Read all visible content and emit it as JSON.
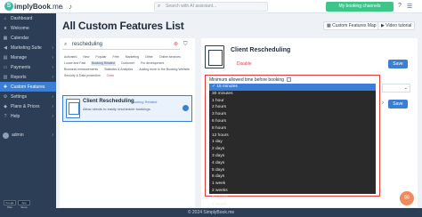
{
  "topbar": {
    "logo_s": "S",
    "logo_text": "implyBook",
    "logo_suffix": ".me",
    "search_placeholder": "Search with AI assistant...",
    "booking_button": "My booking channels"
  },
  "sidebar": {
    "items": [
      {
        "label": "Dashboard",
        "icon": "home-icon",
        "chevron": false
      },
      {
        "label": "Welcome",
        "icon": "star-icon",
        "chevron": false
      },
      {
        "label": "Calendar",
        "icon": "calendar-icon",
        "chevron": false
      },
      {
        "label": "Marketing Suite",
        "icon": "megaphone-icon",
        "chevron": true
      },
      {
        "label": "Manage",
        "icon": "briefcase-icon",
        "chevron": true
      },
      {
        "label": "Payments",
        "icon": "card-icon",
        "chevron": true
      },
      {
        "label": "Reports",
        "icon": "chart-icon",
        "chevron": true
      },
      {
        "label": "Custom Features",
        "icon": "puzzle-icon",
        "chevron": false,
        "active": true
      },
      {
        "label": "Settings",
        "icon": "gear-icon",
        "chevron": true
      },
      {
        "label": "Plans & Prices",
        "icon": "tag-icon",
        "chevron": true
      },
      {
        "label": "Help",
        "icon": "question-icon",
        "chevron": true
      }
    ],
    "user_label": "admin",
    "store_badges": [
      "Google Play",
      "App Store"
    ]
  },
  "page": {
    "title": "All Custom Features List",
    "custom_features_map": "Custom Features Map",
    "video_tutorial": "Video tutorial"
  },
  "left_panel": {
    "search_value": "rescheduling",
    "tags": [
      {
        "label": "Activated",
        "selected": false,
        "red": false
      },
      {
        "label": "New",
        "selected": false,
        "red": false
      },
      {
        "label": "Popular",
        "selected": false,
        "red": false
      },
      {
        "label": "Free",
        "selected": false,
        "red": false
      },
      {
        "label": "Marketing",
        "selected": false,
        "red": false
      },
      {
        "label": "Other",
        "selected": false,
        "red": false
      },
      {
        "label": "Online services",
        "selected": false,
        "red": false
      },
      {
        "label": "Loose and Fast",
        "selected": false,
        "red": false
      },
      {
        "label": "Booking Related",
        "selected": true,
        "red": false
      },
      {
        "label": "Customer",
        "selected": false,
        "red": false
      },
      {
        "label": "For development",
        "selected": false,
        "red": false
      },
      {
        "label": "Business enhancements",
        "selected": false,
        "red": false
      },
      {
        "label": "Statistics & Analytics",
        "selected": false,
        "red": false
      },
      {
        "label": "Adding more to the Booking Website",
        "selected": false,
        "red": false
      },
      {
        "label": "Security & Data protection",
        "selected": false,
        "red": false
      },
      {
        "label": "Clear",
        "selected": false,
        "red": true
      }
    ],
    "card": {
      "title": "Client Rescheduling",
      "badge": "Booking Related",
      "description": "Allow clients to easily reschedule bookings."
    }
  },
  "right_panel": {
    "title": "Client Rescheduling",
    "disable_label": "Disable",
    "save_label": "Save",
    "dropdown_label": "Minimum allowed time before booking",
    "help_glyph": "?",
    "options": [
      "✓ 15 minutes",
      "30 minutes",
      "1 hour",
      "2 hours",
      "3 hours",
      "6 hours",
      "8 hours",
      "12 hours",
      "1 day",
      "2 days",
      "3 days",
      "4 days",
      "5 days",
      "6 days",
      "1 week",
      "2 weeks",
      "3 weeks",
      "1 month"
    ],
    "selected_index": 0
  },
  "footer": {
    "text": "© 2024 SimplyBook.me"
  },
  "colors": {
    "accent": "#3a7fd5",
    "sidebar_bg": "#2c3e55",
    "green": "#3fc48a",
    "highlight": "#e23b3b",
    "danger_text": "#d24a4a"
  }
}
